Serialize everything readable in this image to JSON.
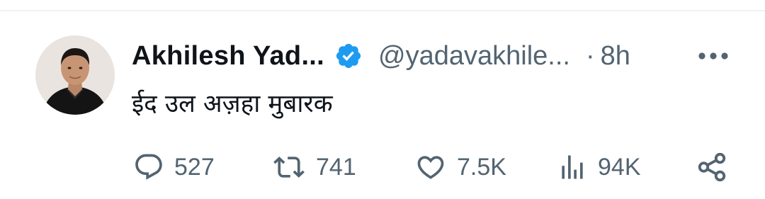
{
  "tweet": {
    "display_name": "Akhilesh Yad...",
    "handle": "@yadavakhile...",
    "separator": "·",
    "time": "8h",
    "text": "ईद उल अज़हा मुबारक",
    "verified": true,
    "avatar_icon": "user-avatar-photo"
  },
  "actions": {
    "reply": {
      "icon": "reply-icon",
      "count": "527"
    },
    "retweet": {
      "icon": "retweet-icon",
      "count": "741"
    },
    "like": {
      "icon": "heart-icon",
      "count": "7.5K"
    },
    "views": {
      "icon": "views-bar-chart-icon",
      "count": "94K"
    },
    "share": {
      "icon": "share-icon"
    }
  },
  "colors": {
    "text_primary": "#0f1419",
    "text_secondary": "#536471",
    "verified_blue": "#1d9bf0",
    "divider": "#eff3f4"
  }
}
